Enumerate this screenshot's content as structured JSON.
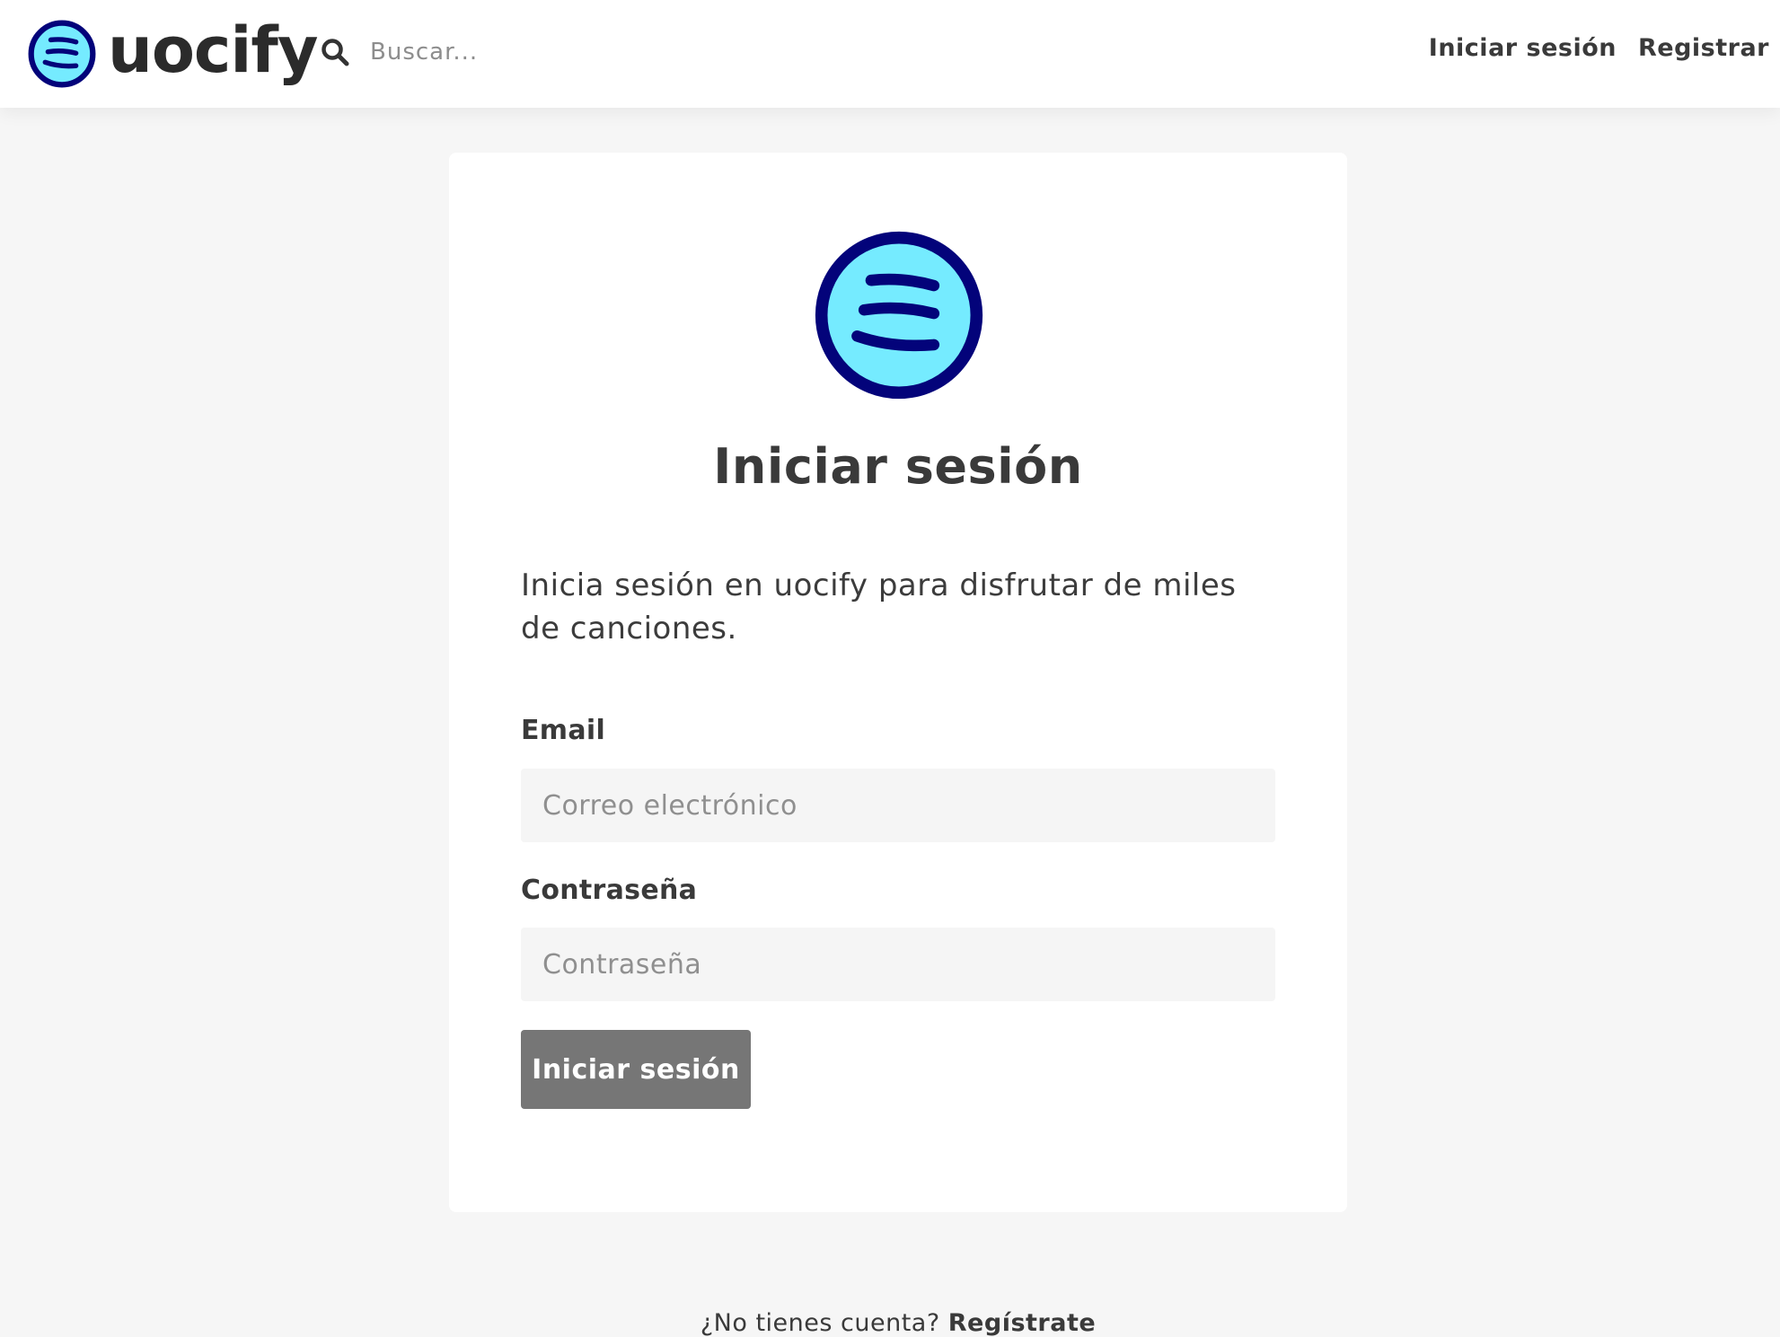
{
  "brand": {
    "name": "uocify"
  },
  "header": {
    "search_placeholder": "Buscar...",
    "nav": {
      "login_label": "Iniciar sesión",
      "register_label": "Registrar"
    }
  },
  "login_card": {
    "title": "Iniciar sesión",
    "description": "Inicia sesión en uocify para disfrutar de miles de canciones.",
    "email": {
      "label": "Email",
      "placeholder": "Correo electrónico",
      "value": ""
    },
    "password": {
      "label": "Contraseña",
      "placeholder": "Contraseña",
      "value": ""
    },
    "submit_label": "Iniciar sesión",
    "signup_prompt": "¿No tienes cuenta?",
    "signup_link": "Regístrate"
  },
  "icons": {
    "logo": "uocify-logo-icon",
    "search": "search-icon"
  },
  "colors": {
    "logo_fill": "#75ebff",
    "logo_ring": "#03037a",
    "button_bg": "#767676",
    "page_bg": "#f6f6f6",
    "input_bg": "#f5f5f5",
    "text_dark": "#3a3a3a"
  }
}
